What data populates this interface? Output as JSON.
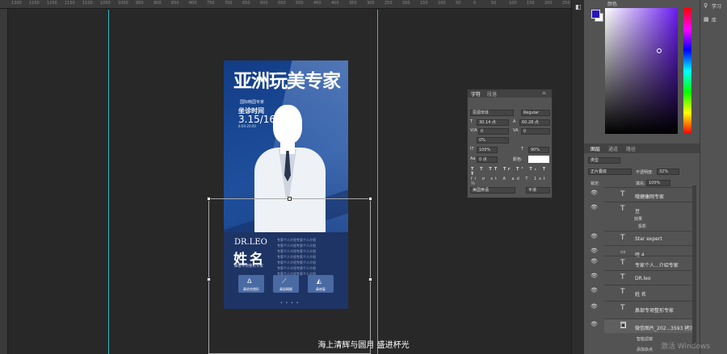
{
  "ruler_ticks": [
    "1300",
    "1250",
    "1200",
    "1150",
    "1100",
    "1050",
    "1000",
    "950",
    "900",
    "850",
    "800",
    "750",
    "700",
    "650",
    "600",
    "550",
    "500",
    "450",
    "400",
    "350",
    "300",
    "250",
    "200",
    "150",
    "100",
    "50",
    "0",
    "50",
    "100",
    "150",
    "200",
    "250"
  ],
  "poster": {
    "title": "亚洲玩美专家",
    "subtitle": "国际韩国专家",
    "time_label": "坐诊时间",
    "date": "3.15/16",
    "small": "8:00-20:00",
    "name_en": "DR.LEO",
    "name_cn": "姓名",
    "role": "鼻部专项整形专家",
    "bio_lines": [
      "专家个人介绍专家个人介绍",
      "专家个人介绍专家个人介绍",
      "专家个人介绍专家个人介绍",
      "专家个人介绍专家个人介绍",
      "专家个人介绍专家个人介绍",
      "专家个人介绍专家个人介绍",
      "专家个人介绍专家个人介绍"
    ],
    "buttons": [
      {
        "icon": "nose-icon",
        "glyph": "ᐃ",
        "label": "鼻综合塑形"
      },
      {
        "icon": "scalpel-icon",
        "glyph": "⟋",
        "label": "鼻部精细"
      },
      {
        "icon": "chin-icon",
        "glyph": "◭",
        "label": "鼻修复"
      }
    ],
    "dots": "• • • •"
  },
  "caption": "海上清辉与圆月 盛进杯光",
  "char_panel": {
    "tabs": [
      "字符",
      "段落"
    ],
    "font": "思源宋体",
    "style": "Regular",
    "size": "30.14 点",
    "leading": "60.28 点",
    "kerning": "0",
    "tracking": "0",
    "scale_pct": "0%",
    "vscale": "100%",
    "hscale": "90%",
    "baseline": "0 点",
    "color_label": "颜色:",
    "language": "美国英语",
    "aa": "平滑"
  },
  "color_panel": {
    "title": "颜色"
  },
  "far_right": {
    "learn": "学习",
    "library": "库"
  },
  "layers_panel": {
    "tabs": [
      "图层",
      "通道",
      "路径"
    ],
    "kind_filter": "类型",
    "blend": "正片叠底",
    "opacity_label": "不透明度:",
    "opacity": "32%",
    "lock_label": "锁定:",
    "fill_label": "填充:",
    "fill": "100%",
    "layers": [
      {
        "type": "T",
        "name": "哦健康网专家"
      },
      {
        "type": "T",
        "name": "豆"
      },
      {
        "type": "fx",
        "name": "效果"
      },
      {
        "type": "fx",
        "name": "投影"
      },
      {
        "type": "T",
        "name": "Star expert"
      },
      {
        "type": "group",
        "name": "组 4"
      },
      {
        "type": "T",
        "name": "专家个人...介绍专家"
      },
      {
        "type": "T",
        "name": "DR.leo"
      },
      {
        "type": "T",
        "name": "姓 名"
      },
      {
        "type": "T",
        "name": "鼻部专项整形专家"
      },
      {
        "type": "img",
        "name": "微信图片_202...3593 拷贝"
      },
      {
        "type": "fx",
        "name": "智能滤镜"
      },
      {
        "type": "fx",
        "name": "添加杂点"
      }
    ]
  },
  "watermark": "激活 Windows"
}
